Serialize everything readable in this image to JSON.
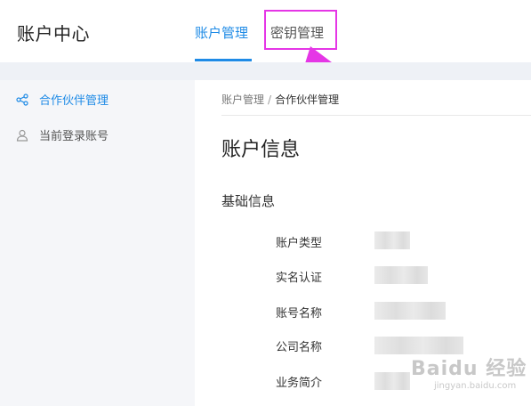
{
  "header": {
    "app_title": "账户中心",
    "tabs": [
      {
        "label": "账户管理",
        "active": true
      },
      {
        "label": "密钥管理",
        "active": false
      }
    ],
    "accent_color": "#1f8be6",
    "highlight_color": "#e536e6"
  },
  "sidebar": {
    "items": [
      {
        "label": "合作伙伴管理",
        "icon": "share-icon",
        "active": true
      },
      {
        "label": "当前登录账号",
        "icon": "user-icon",
        "active": false
      }
    ]
  },
  "main": {
    "breadcrumb": {
      "parent": "账户管理",
      "separator": "/",
      "current": "合作伙伴管理"
    },
    "page_title": "账户信息",
    "section_title": "基础信息",
    "fields": [
      {
        "label": "账户类型"
      },
      {
        "label": "实名认证"
      },
      {
        "label": "账号名称"
      },
      {
        "label": "公司名称"
      },
      {
        "label": "业务简介"
      }
    ]
  },
  "watermark": {
    "text": "Baidu 经验",
    "sub": "jingyan.baidu.com"
  }
}
